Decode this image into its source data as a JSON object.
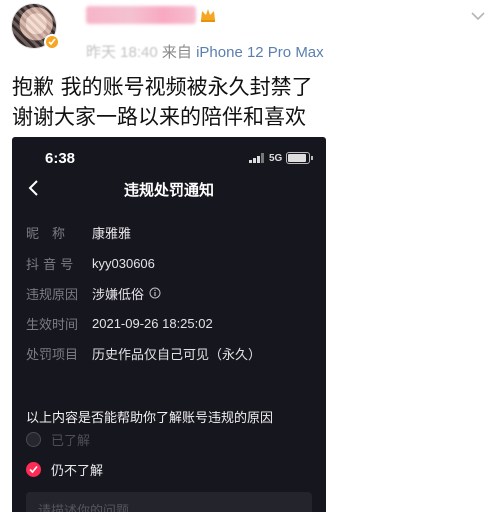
{
  "post": {
    "time": "昨天 18:40",
    "source_prefix": "来自",
    "device": "iPhone 12 Pro Max",
    "lines": [
      "抱歉 我的账号视频被永久封禁了",
      "谢谢大家一路以来的陪伴和喜欢"
    ]
  },
  "phone": {
    "status": {
      "time": "6:38",
      "network": "5G",
      "battery_level": 0.8
    },
    "nav_title": "违规处罚通知",
    "fields": [
      {
        "label": "昵　称",
        "value": "康雅雅"
      },
      {
        "label": "抖 音 号",
        "value": "kyy030606"
      },
      {
        "label": "违规原因",
        "value": "涉嫌低俗"
      },
      {
        "label": "生效时间",
        "value": "2021-09-26 18:25:02"
      },
      {
        "label": "处罚项目",
        "value": "历史作品仅自己可见（永久）"
      }
    ],
    "question": "以上内容是否能帮助你了解账号违规的原因",
    "options": [
      {
        "label": "已了解",
        "checked": false
      },
      {
        "label": "仍不了解",
        "checked": true
      }
    ],
    "input_placeholder": "请描述你的问题"
  },
  "colors": {
    "accent": "#fe2c55",
    "device_link": "#5a7fb0",
    "username_pink": "#f7b4c8",
    "vip_gold": "#f5a623"
  }
}
